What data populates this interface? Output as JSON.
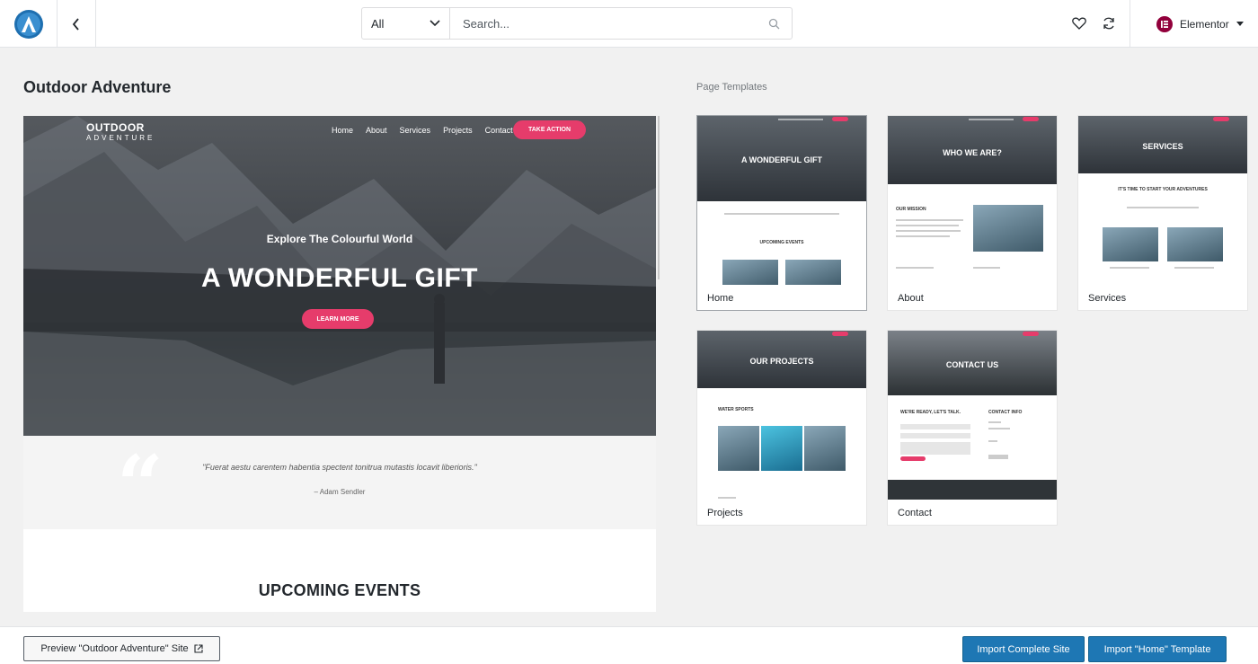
{
  "topbar": {
    "filter": {
      "selected": "All"
    },
    "search": {
      "placeholder": "Search..."
    },
    "builder": {
      "label": "Elementor"
    }
  },
  "site": {
    "title": "Outdoor Adventure"
  },
  "templates_label": "Page Templates",
  "preview": {
    "logo_main": "OUTDOOR",
    "logo_sub": "ADVENTURE",
    "nav": [
      "Home",
      "About",
      "Services",
      "Projects",
      "Contact"
    ],
    "cta": "TAKE ACTION",
    "subtitle": "Explore The Colourful World",
    "title": "A WONDERFUL GIFT",
    "button": "LEARN MORE",
    "quote_mark": "“",
    "quote": "\"Fuerat aestu carentem habentia spectent tonitrua mutastis locavit liberioris.\"",
    "quote_author": "– Adam Sendler",
    "events_title": "UPCOMING EVENTS"
  },
  "templates": [
    {
      "label": "Home",
      "banner": "A WONDERFUL GIFT",
      "section1": "UPCOMING EVENTS"
    },
    {
      "label": "About",
      "banner": "WHO WE ARE?",
      "section1": "OUR MISSION"
    },
    {
      "label": "Services",
      "banner": "SERVICES",
      "section1": "IT'S TIME TO START YOUR ADVENTURES"
    },
    {
      "label": "Projects",
      "banner": "OUR PROJECTS",
      "section1": "WATER SPORTS"
    },
    {
      "label": "Contact",
      "banner": "CONTACT US",
      "section1": "WE'RE READY, LET'S TALK.",
      "section2": "CONTACT INFO"
    }
  ],
  "footer": {
    "preview_button": "Preview \"Outdoor Adventure\" Site",
    "import_site": "Import Complete Site",
    "import_template": "Import \"Home\" Template"
  },
  "colors": {
    "accent": "#e63c6b",
    "primary": "#1e77b4",
    "elementor": "#92003b"
  },
  "icons": [
    "astra-logo-icon",
    "back-arrow-icon",
    "chevron-down-icon",
    "search-icon",
    "heart-icon",
    "sync-icon",
    "elementor-icon",
    "caret-down-icon",
    "external-link-icon"
  ]
}
